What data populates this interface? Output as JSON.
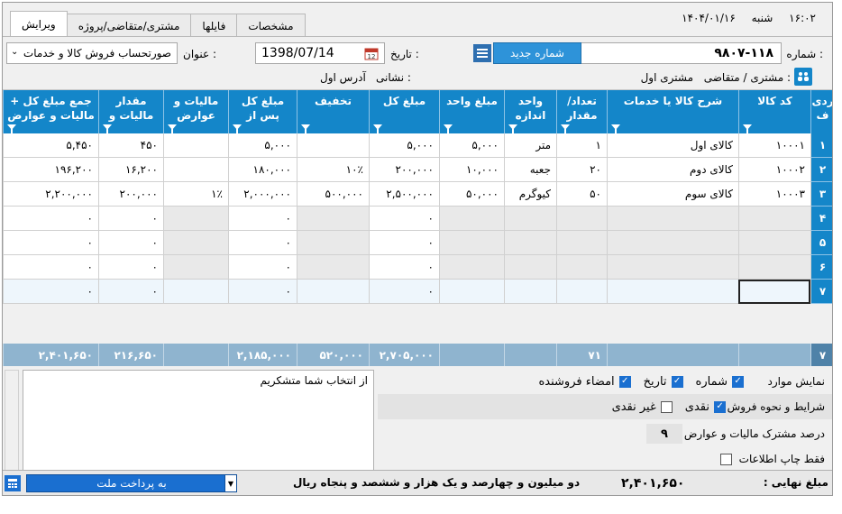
{
  "tabs": [
    "ویرایش",
    "مشتری/متقاضی/پروژه",
    "فایلها",
    "مشخصات"
  ],
  "clock": {
    "time": "۱۶:۰۲",
    "day": "شنبه",
    "date": "۱۴۰۴/۰۱/۱۶"
  },
  "header": {
    "number_label": "شماره :",
    "number_value": "۹۸۰۷-۱۱۸",
    "new_number_button": "شماره جدید",
    "date_label": "تاریخ :",
    "date_value": "1398/07/14",
    "title_label": "عنوان :",
    "title_value": "صورتحساب فروش کالا و خدمات",
    "customer_label": "مشتری / متقاضی :",
    "customer_value": "مشتری اول",
    "address_label": "نشانی :",
    "address_value": "آدرس اول"
  },
  "grid": {
    "columns": [
      {
        "key": "rn",
        "label": "ردی\nف"
      },
      {
        "key": "code",
        "label": "کد کالا"
      },
      {
        "key": "desc",
        "label": "شرح کالا یا خدمات"
      },
      {
        "key": "qty",
        "label": "تعداد/\nمقدار"
      },
      {
        "key": "unit",
        "label": "واحد\nاندازه"
      },
      {
        "key": "price",
        "label": "مبلغ واحد"
      },
      {
        "key": "total",
        "label": "مبلغ کل"
      },
      {
        "key": "disc",
        "label": "تخفیف"
      },
      {
        "key": "net",
        "label": "مبلغ کل\nپس از"
      },
      {
        "key": "taxp",
        "label": "مالیات و\nعوارض"
      },
      {
        "key": "tax",
        "label": "مقدار\nمالیات و"
      },
      {
        "key": "grand",
        "label": "جمع مبلغ کل +\nمالیات و عوارض"
      }
    ],
    "rows": [
      {
        "rn": "۱",
        "code": "۱۰۰۰۱",
        "desc": "کالای اول",
        "qty": "۱",
        "unit": "متر",
        "price": "۵,۰۰۰",
        "total": "۵,۰۰۰",
        "disc": "",
        "net": "۵,۰۰۰",
        "taxp": "",
        "tax": "۴۵۰",
        "grand": "۵,۴۵۰"
      },
      {
        "rn": "۲",
        "code": "۱۰۰۰۲",
        "desc": "کالای دوم",
        "qty": "۲۰",
        "unit": "جعبه",
        "price": "۱۰,۰۰۰",
        "total": "۲۰۰,۰۰۰",
        "disc": "۱۰٪",
        "net": "۱۸۰,۰۰۰",
        "taxp": "",
        "tax": "۱۶,۲۰۰",
        "grand": "۱۹۶,۲۰۰"
      },
      {
        "rn": "۳",
        "code": "۱۰۰۰۳",
        "desc": "کالای سوم",
        "qty": "۵۰",
        "unit": "کیوگرم",
        "price": "۵۰,۰۰۰",
        "total": "۲,۵۰۰,۰۰۰",
        "disc": "۵۰۰,۰۰۰",
        "net": "۲,۰۰۰,۰۰۰",
        "taxp": "۱٪",
        "tax": "۲۰۰,۰۰۰",
        "grand": "۲,۲۰۰,۰۰۰"
      },
      {
        "rn": "۴",
        "code": "",
        "desc": "",
        "qty": "",
        "unit": "",
        "price": "",
        "total": "۰",
        "disc": "",
        "net": "۰",
        "taxp": "",
        "tax": "۰",
        "grand": "۰"
      },
      {
        "rn": "۵",
        "code": "",
        "desc": "",
        "qty": "",
        "unit": "",
        "price": "",
        "total": "۰",
        "disc": "",
        "net": "۰",
        "taxp": "",
        "tax": "۰",
        "grand": "۰"
      },
      {
        "rn": "۶",
        "code": "",
        "desc": "",
        "qty": "",
        "unit": "",
        "price": "",
        "total": "۰",
        "disc": "",
        "net": "۰",
        "taxp": "",
        "tax": "۰",
        "grand": "۰"
      },
      {
        "rn": "۷",
        "code": "",
        "desc": "",
        "qty": "",
        "unit": "",
        "price": "",
        "total": "۰",
        "disc": "",
        "net": "۰",
        "taxp": "",
        "tax": "۰",
        "grand": "۰"
      }
    ],
    "totals": {
      "rn": "۷",
      "code": "",
      "desc": "",
      "qty": "۷۱",
      "unit": "",
      "price": "",
      "total": "۲,۷۰۵,۰۰۰",
      "disc": "۵۲۰,۰۰۰",
      "net": "۲,۱۸۵,۰۰۰",
      "taxp": "",
      "tax": "۲۱۶,۶۵۰",
      "grand": "۲,۴۰۱,۶۵۰"
    }
  },
  "notes_text": "از انتخاب شما متشکریم",
  "options": {
    "show_items_label": "نمایش موارد",
    "show_number": "شماره",
    "show_date": "تاریخ",
    "show_signature": "امضاء فروشنده",
    "terms_label": "شرایط و نحوه فروش",
    "cash": "نقدی",
    "non_cash": "غیر نقدی",
    "tax_percent_label": "درصد مشترک مالیات و عوارض",
    "tax_percent_value": "۹",
    "print_info_only": "فقط چاپ اطلاعات"
  },
  "status": {
    "payment_method": "به پرداخت ملت",
    "amount_words": "دو میلیون و چهارصد و  یک هزار و ششصد و پنجاه ریال",
    "final_label": "مبلغ نهایی :",
    "final_value": "۲,۴۰۱,۶۵۰"
  },
  "colors": {
    "header_blue": "#1486c9",
    "button_blue": "#2e93d9",
    "totals_bar": "#8fb4cf"
  }
}
